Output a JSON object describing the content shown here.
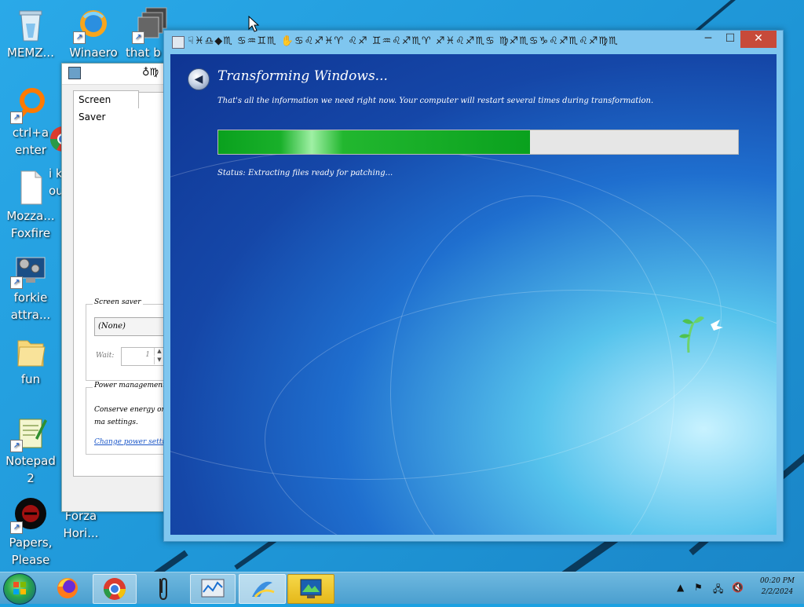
{
  "desktop": {
    "icons": [
      {
        "label": "MEMZ...",
        "icon": "recycle-bin-icon"
      },
      {
        "label": "Winaero",
        "icon": "winaero-icon"
      },
      {
        "label": "that b",
        "icon": "stacked-windows-icon"
      },
      {
        "label": "ctrl+a enter",
        "icon": "orange-ring-icon"
      },
      {
        "label": "Mozza... Foxfire",
        "icon": "blank-document-icon"
      },
      {
        "label": "forkie attra...",
        "icon": "monitor-gear-icon"
      },
      {
        "label": "fun",
        "icon": "folder-icon"
      },
      {
        "label": "Notepad 2",
        "icon": "notepad-icon"
      },
      {
        "label": "Papers, Please",
        "icon": "papers-please-icon"
      },
      {
        "label": "Forza Hori...",
        "icon": "forza-icon"
      }
    ],
    "partial_texts": [
      "i k",
      "ou"
    ]
  },
  "back_window": {
    "title_glyphs": "♁♍",
    "tab_label": "Screen Saver",
    "screensaver_group_label": "Screen saver",
    "screensaver_select_value": "(None)",
    "wait_label": "Wait:",
    "wait_value": "1",
    "power_group_label": "Power management",
    "power_text": "Conserve energy or ma settings.",
    "power_link": "Change power settings"
  },
  "main_window": {
    "title": "☟♓♎◆♏ ♋♒♊♏ ✋♋♌♐♓♈ ♌♐ ♊♒♌♐♏♈ ♐♓♌♐♏♋ ♍♐♏♋♑♌♐♏♌♐♍♏",
    "heading": "Transforming Windows...",
    "subtext": "That's all the information we need right now. Your computer will restart several times during transformation.",
    "progress_fraction": 0.6,
    "status": "Status: Extracting files ready for patching..."
  },
  "taskbar": {
    "items": [
      {
        "icon": "start-orb-icon"
      },
      {
        "icon": "firefox-icon"
      },
      {
        "icon": "chrome-icon"
      },
      {
        "icon": "paperclip-icon"
      },
      {
        "icon": "performance-monitor-icon"
      },
      {
        "icon": "windows-setup-icon"
      },
      {
        "icon": "display-settings-icon"
      }
    ],
    "clock_time": "00:20 PM",
    "clock_date": "2/2/2024"
  },
  "colors": {
    "desktop": "#1ba1e2",
    "progress_fill": "#0aa11e",
    "close_button": "#c74a3a"
  }
}
